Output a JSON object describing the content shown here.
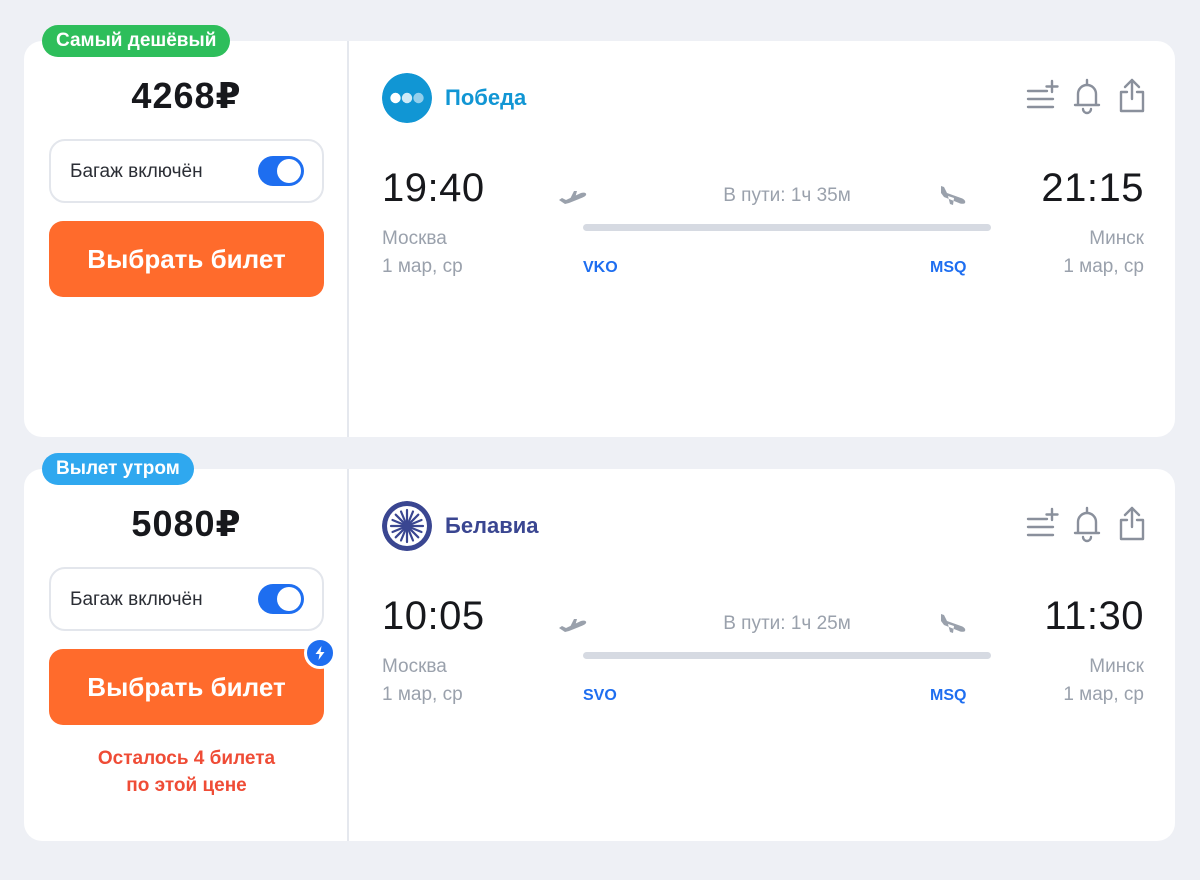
{
  "colors": {
    "badge_cheapest": "#2ebe5b",
    "badge_morning": "#2fa8ef",
    "button": "#ff6b2c",
    "link_blue": "#1e6ef0",
    "warning": "#ef4c36",
    "pobeda": "#1196d4",
    "belavia": "#3a4691"
  },
  "icons": [
    "add-to-list-icon",
    "bell-icon",
    "share-icon",
    "takeoff-plane-icon",
    "landing-plane-icon",
    "lightning-icon"
  ],
  "tickets": [
    {
      "badge": "Самый дешёвый",
      "price": "4268₽",
      "baggage_label": "Багаж включён",
      "baggage_included": true,
      "button_label": "Выбрать билет",
      "warning_line1": "",
      "warning_line2": "",
      "airline": "Победа",
      "departure": {
        "time": "19:40",
        "city": "Москва",
        "date": "1 мар, ср",
        "airport": "VKO"
      },
      "arrival": {
        "time": "21:15",
        "city": "Минск",
        "date": "1 мар, ср",
        "airport": "MSQ"
      },
      "duration": "В пути: 1ч 35м"
    },
    {
      "badge": "Вылет утром",
      "price": "5080₽",
      "baggage_label": "Багаж включён",
      "baggage_included": true,
      "button_label": "Выбрать билет",
      "warning_line1": "Осталось 4 билета",
      "warning_line2": "по этой цене",
      "airline": "Белавиа",
      "departure": {
        "time": "10:05",
        "city": "Москва",
        "date": "1 мар, ср",
        "airport": "SVO"
      },
      "arrival": {
        "time": "11:30",
        "city": "Минск",
        "date": "1 мар, ср",
        "airport": "MSQ"
      },
      "duration": "В пути: 1ч 25м"
    }
  ]
}
